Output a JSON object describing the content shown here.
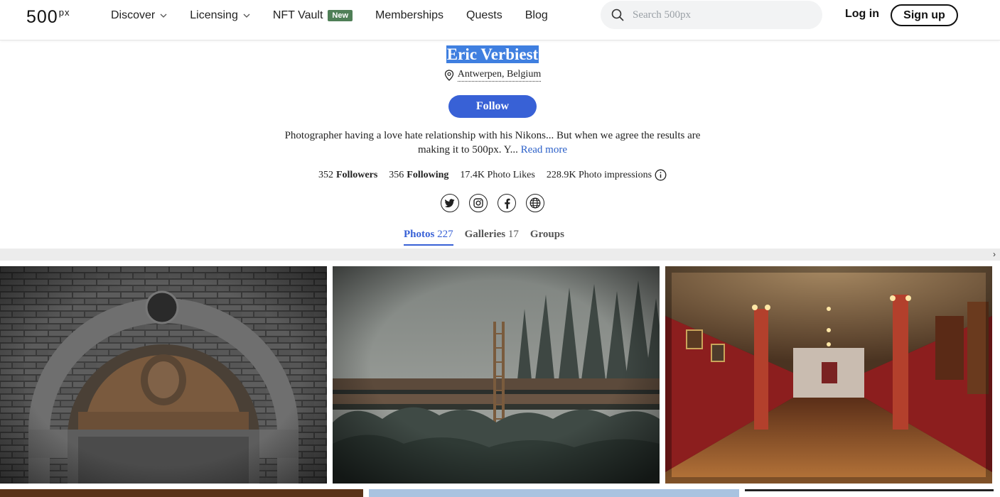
{
  "header": {
    "logo_main": "500",
    "logo_sup": "px",
    "nav": [
      {
        "label": "Discover",
        "dropdown": true
      },
      {
        "label": "Licensing",
        "dropdown": true
      },
      {
        "label": "NFT Vault",
        "badge": "New"
      },
      {
        "label": "Memberships"
      },
      {
        "label": "Quests"
      },
      {
        "label": "Blog"
      }
    ],
    "search_placeholder": "Search 500px",
    "login": "Log in",
    "signup": "Sign up"
  },
  "profile": {
    "name": "Eric Verbiest",
    "location": "Antwerpen, Belgium",
    "follow": "Follow",
    "bio": "Photographer having a love hate relationship with his Nikons... But when we agree the results are making it to 500px. Y...",
    "read_more": "Read more",
    "stats": [
      {
        "value": "352",
        "label": "Followers",
        "bold": true
      },
      {
        "value": "356",
        "label": "Following",
        "bold": true
      },
      {
        "value": "17.4K",
        "label": "Photo Likes",
        "bold": false
      },
      {
        "value": "228.9K",
        "label": "Photo impressions",
        "bold": false
      }
    ],
    "socials": [
      "twitter-icon",
      "instagram-icon",
      "facebook-icon",
      "website-icon"
    ]
  },
  "tabs": [
    {
      "label": "Photos",
      "count": "227",
      "active": true
    },
    {
      "label": "Galleries",
      "count": "17",
      "active": false
    },
    {
      "label": "Groups",
      "count": "",
      "active": false
    }
  ],
  "colors": {
    "accent": "#3861d6",
    "name_highlight": "#3f7fe0",
    "badge": "#4f7f57"
  }
}
